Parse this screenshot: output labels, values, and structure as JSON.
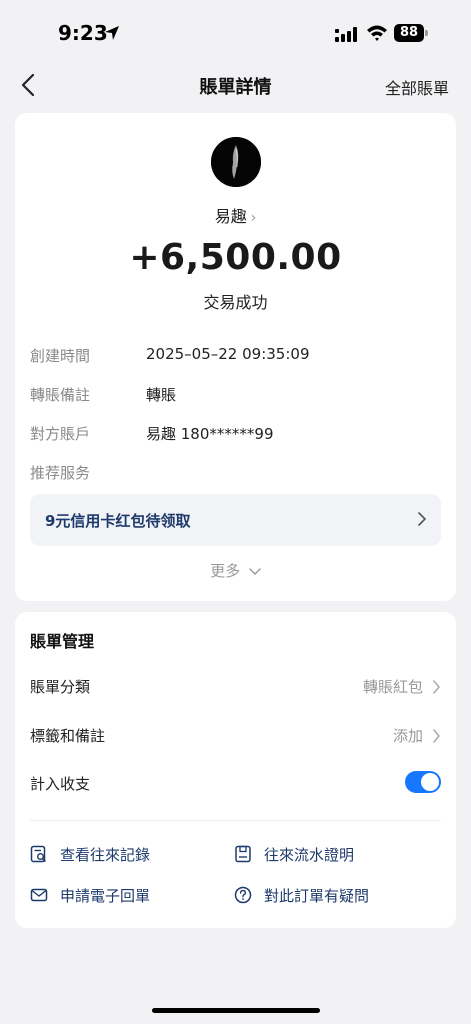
{
  "status_bar": {
    "time": "9:23",
    "battery": "88"
  },
  "nav": {
    "title": "賬單詳情",
    "right_link": "全部賬單"
  },
  "transaction": {
    "payee": "易趣",
    "amount": "+6,500.00",
    "status": "交易成功",
    "details": [
      {
        "label": "創建時間",
        "value": "2025–05–22 09:35:09"
      },
      {
        "label": "轉賬備註",
        "value": "轉賬"
      },
      {
        "label": "對方賬戶",
        "value": "易趣 180******99"
      }
    ],
    "recommend_label": "推荐服务",
    "promo_text": "9元信用卡红包待领取",
    "more_label": "更多"
  },
  "management": {
    "title": "賬單管理",
    "category": {
      "label": "賬單分類",
      "value": "轉賬紅包"
    },
    "tags": {
      "label": "標籤和備註",
      "value": "添加"
    },
    "include": {
      "label": "計入收支",
      "enabled": true
    },
    "links": [
      {
        "label": "查看往來記錄",
        "icon": "search-record-icon"
      },
      {
        "label": "往來流水證明",
        "icon": "document-icon"
      },
      {
        "label": "申請電子回單",
        "icon": "mail-icon"
      },
      {
        "label": "對此訂單有疑問",
        "icon": "question-icon"
      }
    ]
  },
  "colors": {
    "accent": "#1677ff",
    "link": "#1e3a6b",
    "background": "#f2f2f5"
  }
}
